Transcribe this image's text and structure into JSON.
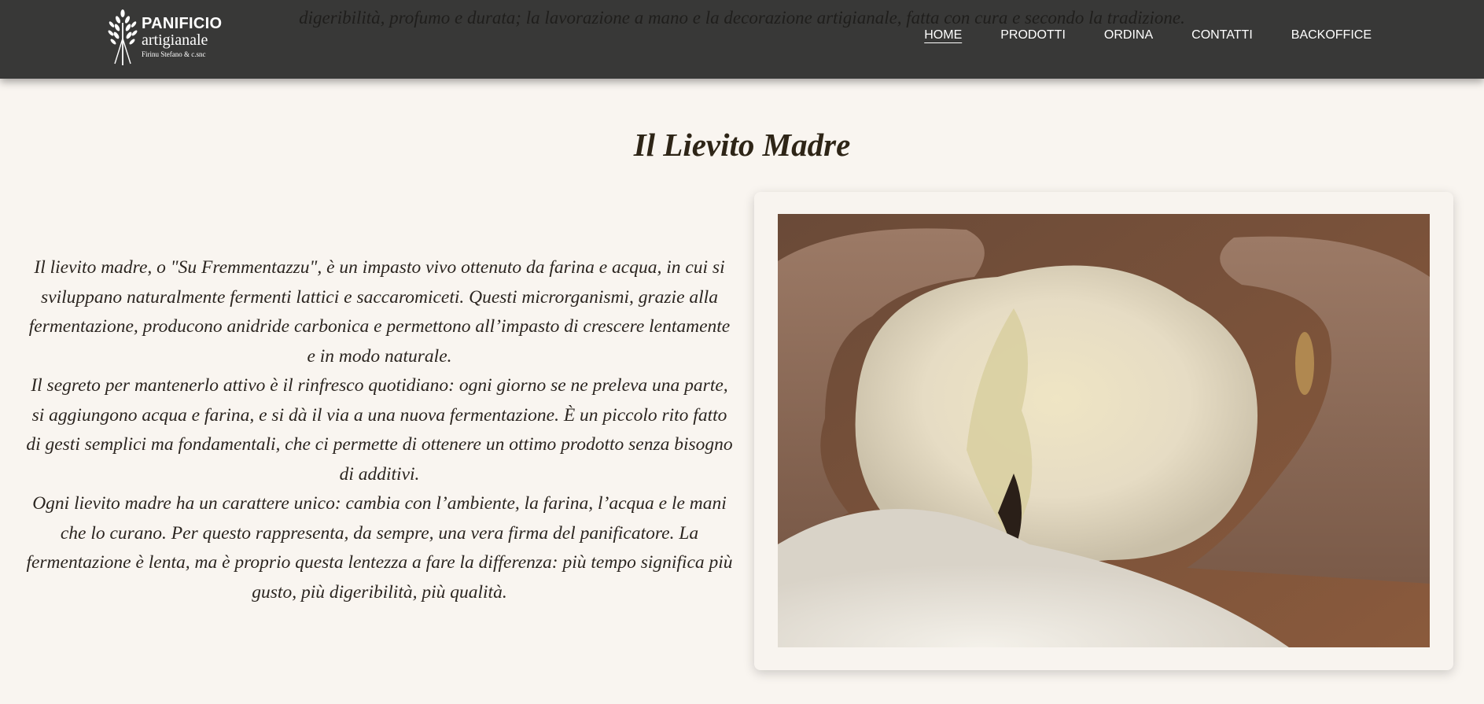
{
  "background_text": "digeribilità, profumo e durata; la lavorazione a mano e la decorazione artigianale, fatta con cura e secondo la tradizione.",
  "header": {
    "logo": {
      "line1": "PANIFICIO",
      "line2": "artigianale",
      "line3": "Firinu Stefano & c.snc",
      "icon": "wheat-icon"
    },
    "nav": [
      {
        "label": "HOME",
        "active": true
      },
      {
        "label": "PRODOTTI",
        "active": false
      },
      {
        "label": "ORDINA",
        "active": false
      },
      {
        "label": "CONTATTI",
        "active": false
      },
      {
        "label": "BACKOFFICE",
        "active": false
      }
    ]
  },
  "main": {
    "title": "Il Lievito Madre",
    "paragraphs": [
      "Il lievito madre, o \"Su Fremmentazzu\", è un impasto vivo ottenuto da farina e acqua, in cui si sviluppano naturalmente fermenti lattici e saccaromiceti. Questi microrganismi, grazie alla fermentazione, producono anidride carbonica e permettono all’impasto di crescere lentamente e in modo naturale.",
      "Il segreto per mantenerlo attivo è il rinfresco quotidiano: ogni giorno se ne preleva una parte, si aggiungono acqua e farina, e si dà il via a una nuova fermentazione. È un piccolo rito fatto di gesti semplici ma fondamentali, che ci permette di ottenere un ottimo prodotto senza bisogno di additivi.",
      "Ogni lievito madre ha un carattere unico: cambia con l’ambiente, la farina, l’acqua e le mani che lo curano. Per questo rappresenta, da sempre, una vera firma del panificatore. La fermentazione è lenta, ma è proprio questa lentezza a fare la differenza: più tempo significa più gusto, più digeribilità, più qualità."
    ]
  },
  "colors": {
    "navbar": "#2d2d2c",
    "page_bg": "#f9f5f0",
    "title": "#2e2517",
    "text": "#2b2520"
  }
}
